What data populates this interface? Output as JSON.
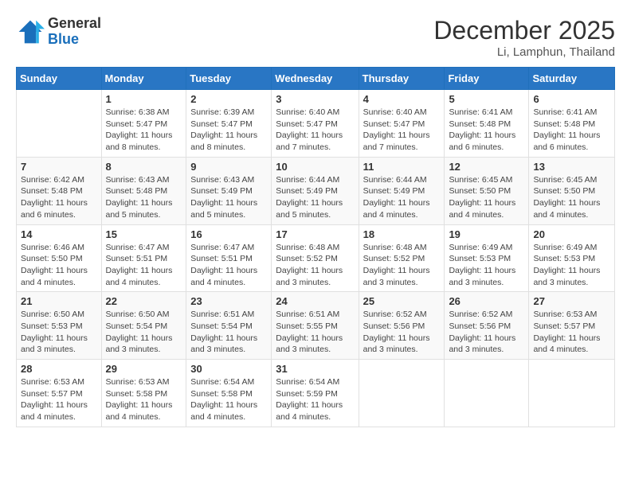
{
  "header": {
    "logo": {
      "general": "General",
      "blue": "Blue"
    },
    "title": "December 2025",
    "location": "Li, Lamphun, Thailand"
  },
  "days_of_week": [
    "Sunday",
    "Monday",
    "Tuesday",
    "Wednesday",
    "Thursday",
    "Friday",
    "Saturday"
  ],
  "weeks": [
    [
      null,
      {
        "day": 1,
        "sunrise": "6:38 AM",
        "sunset": "5:47 PM",
        "daylight": "11 hours and 8 minutes."
      },
      {
        "day": 2,
        "sunrise": "6:39 AM",
        "sunset": "5:47 PM",
        "daylight": "11 hours and 8 minutes."
      },
      {
        "day": 3,
        "sunrise": "6:40 AM",
        "sunset": "5:47 PM",
        "daylight": "11 hours and 7 minutes."
      },
      {
        "day": 4,
        "sunrise": "6:40 AM",
        "sunset": "5:47 PM",
        "daylight": "11 hours and 7 minutes."
      },
      {
        "day": 5,
        "sunrise": "6:41 AM",
        "sunset": "5:48 PM",
        "daylight": "11 hours and 6 minutes."
      },
      {
        "day": 6,
        "sunrise": "6:41 AM",
        "sunset": "5:48 PM",
        "daylight": "11 hours and 6 minutes."
      }
    ],
    [
      {
        "day": 7,
        "sunrise": "6:42 AM",
        "sunset": "5:48 PM",
        "daylight": "11 hours and 6 minutes."
      },
      {
        "day": 8,
        "sunrise": "6:43 AM",
        "sunset": "5:48 PM",
        "daylight": "11 hours and 5 minutes."
      },
      {
        "day": 9,
        "sunrise": "6:43 AM",
        "sunset": "5:49 PM",
        "daylight": "11 hours and 5 minutes."
      },
      {
        "day": 10,
        "sunrise": "6:44 AM",
        "sunset": "5:49 PM",
        "daylight": "11 hours and 5 minutes."
      },
      {
        "day": 11,
        "sunrise": "6:44 AM",
        "sunset": "5:49 PM",
        "daylight": "11 hours and 4 minutes."
      },
      {
        "day": 12,
        "sunrise": "6:45 AM",
        "sunset": "5:50 PM",
        "daylight": "11 hours and 4 minutes."
      },
      {
        "day": 13,
        "sunrise": "6:45 AM",
        "sunset": "5:50 PM",
        "daylight": "11 hours and 4 minutes."
      }
    ],
    [
      {
        "day": 14,
        "sunrise": "6:46 AM",
        "sunset": "5:50 PM",
        "daylight": "11 hours and 4 minutes."
      },
      {
        "day": 15,
        "sunrise": "6:47 AM",
        "sunset": "5:51 PM",
        "daylight": "11 hours and 4 minutes."
      },
      {
        "day": 16,
        "sunrise": "6:47 AM",
        "sunset": "5:51 PM",
        "daylight": "11 hours and 4 minutes."
      },
      {
        "day": 17,
        "sunrise": "6:48 AM",
        "sunset": "5:52 PM",
        "daylight": "11 hours and 3 minutes."
      },
      {
        "day": 18,
        "sunrise": "6:48 AM",
        "sunset": "5:52 PM",
        "daylight": "11 hours and 3 minutes."
      },
      {
        "day": 19,
        "sunrise": "6:49 AM",
        "sunset": "5:53 PM",
        "daylight": "11 hours and 3 minutes."
      },
      {
        "day": 20,
        "sunrise": "6:49 AM",
        "sunset": "5:53 PM",
        "daylight": "11 hours and 3 minutes."
      }
    ],
    [
      {
        "day": 21,
        "sunrise": "6:50 AM",
        "sunset": "5:53 PM",
        "daylight": "11 hours and 3 minutes."
      },
      {
        "day": 22,
        "sunrise": "6:50 AM",
        "sunset": "5:54 PM",
        "daylight": "11 hours and 3 minutes."
      },
      {
        "day": 23,
        "sunrise": "6:51 AM",
        "sunset": "5:54 PM",
        "daylight": "11 hours and 3 minutes."
      },
      {
        "day": 24,
        "sunrise": "6:51 AM",
        "sunset": "5:55 PM",
        "daylight": "11 hours and 3 minutes."
      },
      {
        "day": 25,
        "sunrise": "6:52 AM",
        "sunset": "5:56 PM",
        "daylight": "11 hours and 3 minutes."
      },
      {
        "day": 26,
        "sunrise": "6:52 AM",
        "sunset": "5:56 PM",
        "daylight": "11 hours and 3 minutes."
      },
      {
        "day": 27,
        "sunrise": "6:53 AM",
        "sunset": "5:57 PM",
        "daylight": "11 hours and 4 minutes."
      }
    ],
    [
      {
        "day": 28,
        "sunrise": "6:53 AM",
        "sunset": "5:57 PM",
        "daylight": "11 hours and 4 minutes."
      },
      {
        "day": 29,
        "sunrise": "6:53 AM",
        "sunset": "5:58 PM",
        "daylight": "11 hours and 4 minutes."
      },
      {
        "day": 30,
        "sunrise": "6:54 AM",
        "sunset": "5:58 PM",
        "daylight": "11 hours and 4 minutes."
      },
      {
        "day": 31,
        "sunrise": "6:54 AM",
        "sunset": "5:59 PM",
        "daylight": "11 hours and 4 minutes."
      },
      null,
      null,
      null
    ]
  ]
}
